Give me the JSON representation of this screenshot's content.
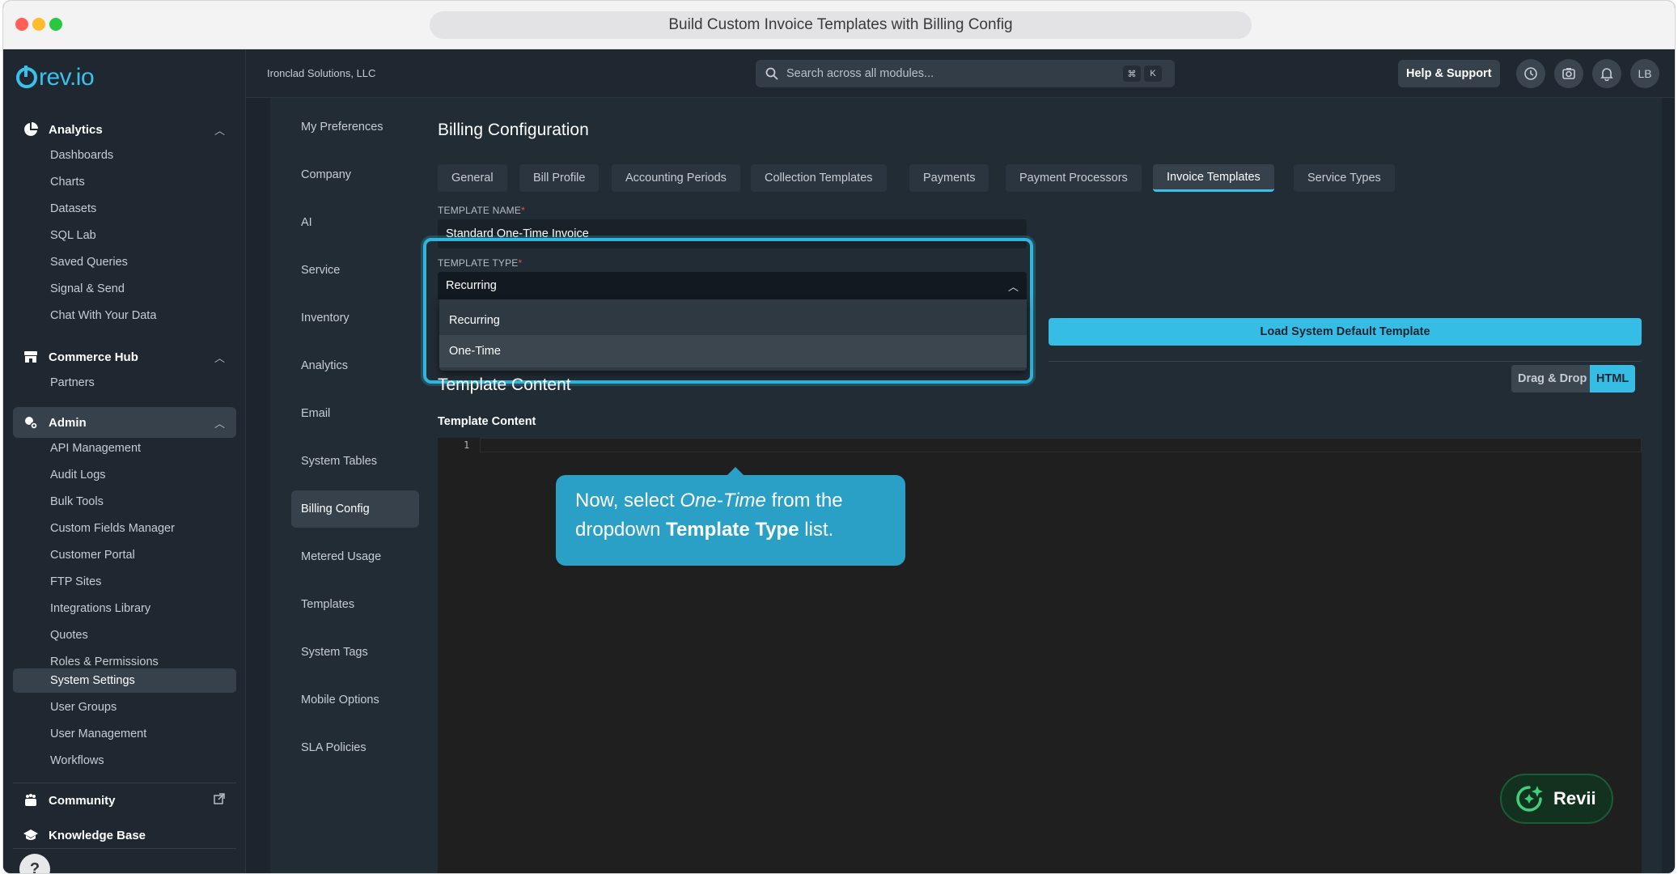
{
  "browser": {
    "title": "Build Custom Invoice Templates with Billing Config"
  },
  "sidebar": {
    "logo": "rev.io",
    "sections": [
      {
        "label": "Analytics",
        "icon": "pie-chart-icon",
        "items": [
          "Dashboards",
          "Charts",
          "Datasets",
          "SQL Lab",
          "Saved Queries",
          "Signal & Send",
          "Chat With Your Data"
        ]
      },
      {
        "label": "Commerce Hub",
        "icon": "store-icon",
        "items": [
          "Partners"
        ]
      },
      {
        "label": "Admin",
        "icon": "admin-gear-icon",
        "items": [
          "API Management",
          "Audit Logs",
          "Bulk Tools",
          "Custom Fields Manager",
          "Customer Portal",
          "FTP Sites",
          "Integrations Library",
          "Quotes",
          "Roles & Permissions",
          "System Settings",
          "User Groups",
          "User Management",
          "Workflows"
        ]
      },
      {
        "label": "Community",
        "icon": "community-icon"
      },
      {
        "label": "Knowledge Base",
        "icon": "graduation-cap-icon"
      }
    ],
    "active_item": "System Settings",
    "help": "?"
  },
  "topbar": {
    "org": "Ironclad Solutions, LLC",
    "search_placeholder": "Search across all modules...",
    "kbd": [
      "⌘",
      "K"
    ],
    "help_label": "Help & Support",
    "avatar": "LB"
  },
  "settings_nav": {
    "items": [
      "My Preferences",
      "Company",
      "AI",
      "Service",
      "Inventory",
      "Analytics",
      "Email",
      "System Tables",
      "Billing Config",
      "Metered Usage",
      "Templates",
      "System Tags",
      "Mobile Options",
      "SLA Policies"
    ],
    "active": "Billing Config"
  },
  "main": {
    "title": "Billing Configuration",
    "tabs": [
      "General",
      "Bill Profile",
      "Accounting Periods",
      "Collection Templates",
      "Payments",
      "Payment Processors",
      "Invoice Templates",
      "Service Types"
    ],
    "active_tab": "Invoice Templates",
    "template_name_label": "TEMPLATE NAME",
    "template_name_value": "Standard One-Time Invoice",
    "template_type_label": "TEMPLATE TYPE",
    "template_type_value": "Recurring",
    "template_type_options": [
      "Recurring",
      "One-Time"
    ],
    "load_button": "Load System Default Template",
    "section_title": "Template Content",
    "toggle": [
      "Drag & Drop",
      "HTML"
    ],
    "editor_label": "Template Content",
    "line_numbers": [
      "1"
    ]
  },
  "tooltip": {
    "line1_pre": "Now, select ",
    "line1_em": "One-Time",
    "line1_post": " from the",
    "line2_pre": "dropdown ",
    "line2_strong": "Template Type",
    "line2_post": " list."
  },
  "assistant": {
    "label": "Revii"
  },
  "colors": {
    "accent": "#35bde6",
    "tooltip": "#2aa0c6",
    "required": "#e8504b"
  }
}
